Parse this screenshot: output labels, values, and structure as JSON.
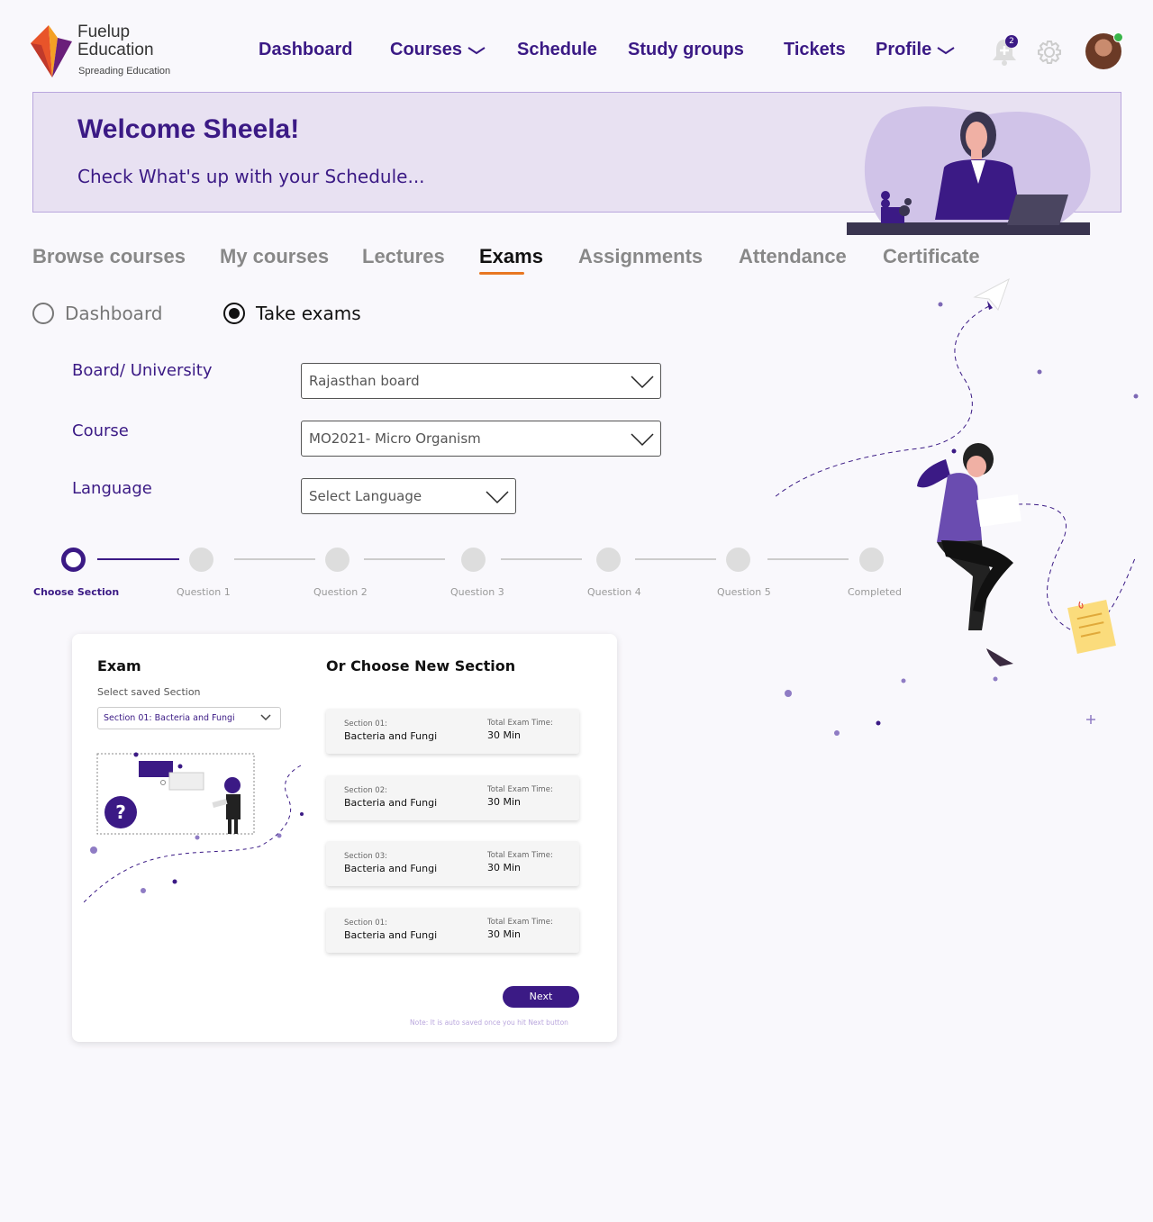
{
  "brand": {
    "name_line1": "Fuelup",
    "name_line2": "Education",
    "tagline": "Spreading Education"
  },
  "nav": {
    "dashboard": "Dashboard",
    "courses": "Courses",
    "schedule": "Schedule",
    "study_groups": "Study groups",
    "tickets": "Tickets",
    "profile": "Profile",
    "notification_count": "2"
  },
  "banner": {
    "title": "Welcome Sheela!",
    "subtitle": "Check What's up with your Schedule..."
  },
  "tabs": [
    "Browse courses",
    "My courses",
    "Lectures",
    "Exams",
    "Assignments",
    "Attendance",
    "Certificate"
  ],
  "active_tab": "Exams",
  "mode": {
    "option1": "Dashboard",
    "option2": "Take exams",
    "selected": "Take exams"
  },
  "form": {
    "board_label": "Board/ University",
    "board_value": "Rajasthan board",
    "course_label": "Course",
    "course_value": "MO2021- Micro Organism",
    "language_label": "Language",
    "language_value": "Select Language"
  },
  "stepper": {
    "steps": [
      "Choose Section",
      "Question 1",
      "Question 2",
      "Question 3",
      "Question 4",
      "Question 5",
      "Completed"
    ],
    "current": 0
  },
  "exam_card": {
    "title": "Exam",
    "saved_label": "Select saved Section",
    "saved_value": "Section 01: Bacteria and Fungi",
    "new_title": "Or Choose New Section",
    "sections": [
      {
        "section": "Section 01:",
        "name": "Bacteria and Fungi",
        "time_label": "Total Exam Time:",
        "time": "30 Min"
      },
      {
        "section": "Section 02:",
        "name": "Bacteria and Fungi",
        "time_label": "Total Exam Time:",
        "time": "30 Min"
      },
      {
        "section": "Section 03:",
        "name": "Bacteria and Fungi",
        "time_label": "Total Exam Time:",
        "time": "30 Min"
      },
      {
        "section": "Section 01:",
        "name": "Bacteria and Fungi",
        "time_label": "Total Exam Time:",
        "time": "30 Min"
      }
    ],
    "next_label": "Next",
    "note": "Note: It is auto saved once you hit Next button",
    "illustration_symbol": "?"
  },
  "colors": {
    "primary": "#3b1a85",
    "accent": "#e87722",
    "banner_bg": "#e8e1f2"
  },
  "icons": [
    "bell-icon",
    "gear-icon",
    "chevron-down-icon",
    "paper-plane-icon"
  ]
}
